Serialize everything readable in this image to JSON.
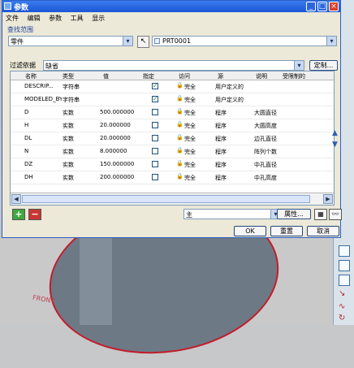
{
  "window": {
    "title": "参数",
    "minimize_label": "_",
    "maximize_label": "□",
    "close_label": "×"
  },
  "menu": [
    "文件",
    "编辑",
    "参数",
    "工具",
    "显示"
  ],
  "scope": {
    "section_label": "查找范围",
    "type_value": "零件",
    "object_value": "PRT0001"
  },
  "filter": {
    "label": "过滤依据",
    "value": "缺省",
    "custom_label": "定制..."
  },
  "table": {
    "columns": [
      "名称",
      "类型",
      "值",
      "指定",
      "访问",
      "源",
      "说明",
      "受限制的"
    ],
    "rows": [
      {
        "name": "DESCRIP...",
        "type": "字符串",
        "value": "",
        "designated": true,
        "access": "完全",
        "source": "用户定义的",
        "desc": "",
        "restricted": ""
      },
      {
        "name": "MODELED_BY",
        "type": "字符串",
        "value": "",
        "designated": true,
        "access": "完全",
        "source": "用户定义的",
        "desc": "",
        "restricted": ""
      },
      {
        "name": "D",
        "type": "实数",
        "value": "500.000000",
        "designated": false,
        "access": "完全",
        "source": "程序",
        "desc": "大圆直径",
        "restricted": ""
      },
      {
        "name": "H",
        "type": "实数",
        "value": "20.000000",
        "designated": false,
        "access": "完全",
        "source": "程序",
        "desc": "大圆高度",
        "restricted": ""
      },
      {
        "name": "DL",
        "type": "实数",
        "value": "20.000000",
        "designated": false,
        "access": "完全",
        "source": "程序",
        "desc": "边孔直径",
        "restricted": ""
      },
      {
        "name": "N",
        "type": "实数",
        "value": "8.000000",
        "designated": false,
        "access": "完全",
        "source": "程序",
        "desc": "阵列个数",
        "restricted": ""
      },
      {
        "name": "DZ",
        "type": "实数",
        "value": "150.000000",
        "designated": false,
        "access": "完全",
        "source": "程序",
        "desc": "中孔直径",
        "restricted": ""
      },
      {
        "name": "DH",
        "type": "实数",
        "value": "200.000000",
        "designated": false,
        "access": "完全",
        "source": "程序",
        "desc": "中孔高度",
        "restricted": ""
      }
    ]
  },
  "footer": {
    "master_value": "主",
    "properties_label": "属性...",
    "ok_label": "OK",
    "reset_label": "重置",
    "cancel_label": "取消"
  },
  "background": {
    "front_label": "FRONT"
  }
}
